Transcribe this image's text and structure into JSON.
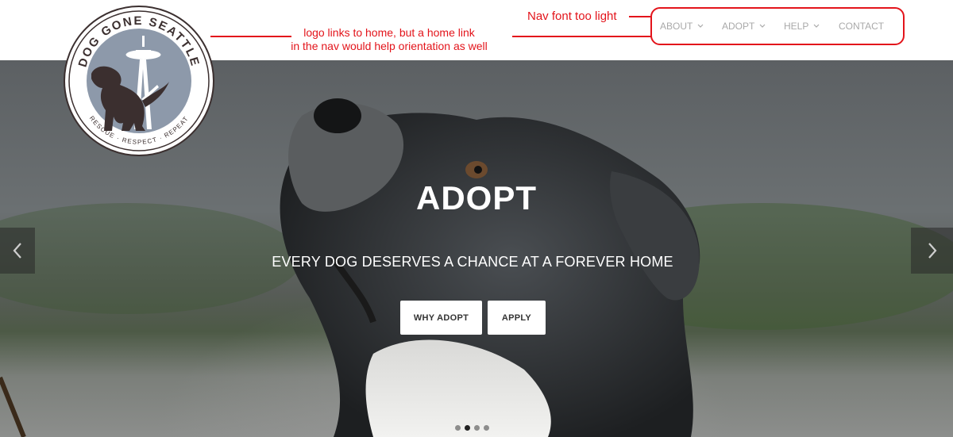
{
  "header": {
    "logo": {
      "brand_text": "DOG GONE SEATTLE",
      "tagline": "RESCUE · RESPECT · REPEAT",
      "icon": "space-needle-dog-icon"
    },
    "nav": [
      {
        "label": "ABOUT",
        "has_dropdown": true
      },
      {
        "label": "ADOPT",
        "has_dropdown": true
      },
      {
        "label": "HELP",
        "has_dropdown": true
      },
      {
        "label": "CONTACT",
        "has_dropdown": false
      }
    ]
  },
  "hero": {
    "title": "ADOPT",
    "subtitle": "EVERY DOG DESERVES A CHANCE AT A FOREVER HOME",
    "buttons": {
      "why_adopt": "WHY ADOPT",
      "apply": "APPLY"
    },
    "slide_count": 4,
    "active_slide": 2,
    "prev_icon": "chevron-left-icon",
    "next_icon": "chevron-right-icon"
  },
  "annotations": {
    "nav_note": "Nav font too light",
    "logo_note_line1": "logo links to home, but a home link",
    "logo_note_line2": "in the nav would help orientation as well",
    "color": "#e3141b"
  },
  "colors": {
    "nav_text": "#a9a9a9",
    "logo_circle": "#8d99aa",
    "logo_dark": "#3b2f2f"
  }
}
